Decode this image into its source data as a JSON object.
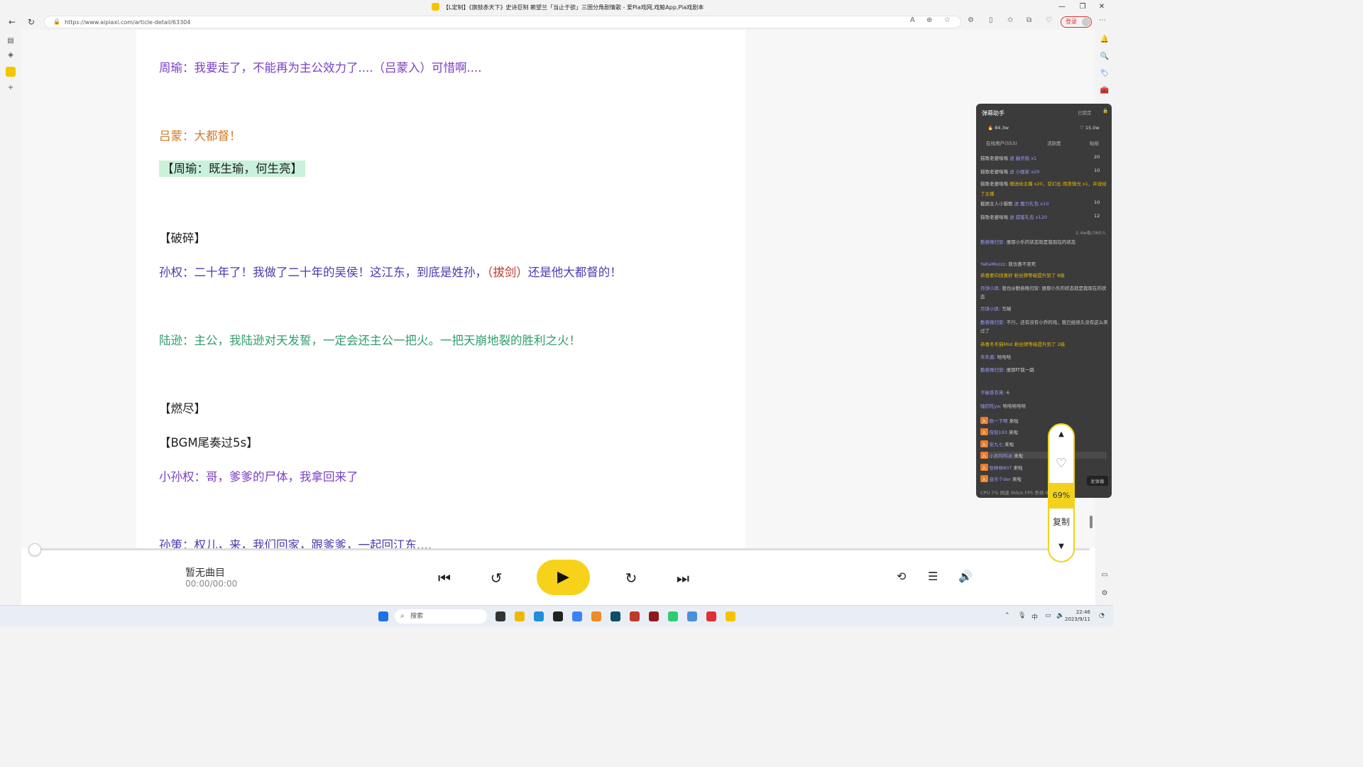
{
  "window": {
    "title": "【L定制】《旗鼓赤天下》史诗巨制 赖望兰「当止于欲」三国分角剧情歌 - 爱Pia戏网,戏鲸App,Pia戏剧本",
    "min_label": "—",
    "restore_label": "❐",
    "close_label": "✕"
  },
  "browser": {
    "url": "https://www.aipiaxi.com/article-detail/63304",
    "login_label": "登录"
  },
  "article": {
    "lines": [
      "周瑜：我要走了，不能再为主公效力了....（吕蒙入）可惜啊....",
      "吕蒙：大都督！",
      "【周瑜：既生瑜，何生亮】",
      "【破碎】",
      "孙权：二十年了！我做了二十年的吴侯！这江东，到底是姓孙，",
      "（拔剑）",
      "还是他大都督的！",
      "陆逊：主公，我陆逊对天发誓，一定会还主公一把火。一把天崩地裂的胜利之火！",
      "【燃尽】",
      "【BGM尾奏过5s】",
      "小孙权：哥，爹爹的尸体，我拿回来了",
      "孙策：权儿，来，我们回家，跟爹爹，一起回江东...."
    ]
  },
  "player": {
    "track_title": "暂无曲目",
    "track_time": "00:00/00:00",
    "progress": 0.0
  },
  "danmu": {
    "title": "弹幕助手",
    "lock_label": "已锁定",
    "hot": "84.3w",
    "likes": "15.0w",
    "tabs": [
      "在线用户(553)",
      "活跃度",
      "贴纸"
    ],
    "viewer_stat": "2.4w条/360人",
    "gifts": [
      {
        "name": "猫歌老婆嗡嗡",
        "text": "送 幽灵船 x1",
        "count": "20"
      },
      {
        "name": "猫歌老婆嗡嗡",
        "text": "送 小画家 x20",
        "count": "10"
      },
      {
        "name": "猫歌老婆嗡嗡",
        "text": "赠送给主播 x20，变幻出 雨夜微光 x1，并说给了主播",
        "count": ""
      },
      {
        "name": "截据主人小猫歌",
        "text": "送 魔力礼包 x10",
        "count": "10"
      },
      {
        "name": "猫歌老婆嗡嗡",
        "text": "送 甜蜜礼包 x120",
        "count": "12"
      }
    ],
    "messages": [
      {
        "user": "勤奋晚归安:",
        "text": "册那小乐的状态就是我现在的状态"
      },
      {
        "user": "YaKaMozzz:",
        "text": "我也喜不至死"
      },
      {
        "user": "",
        "text": "恭喜要向线喜好 粉丝牌等级提升到了 8级"
      },
      {
        "user": "月饼小凤:",
        "text": "我也@勤奋晚归安: 册那小乐的状态就是我现在的状态"
      },
      {
        "user": "月饼小凤:",
        "text": "写贼"
      },
      {
        "user": "勤奋晚归安:",
        "text": "不行，还有没有小乔的戏，我已经很久没有这么笑过了"
      },
      {
        "user": "",
        "text": "恭喜冬冬猫Mist 粉丝牌等级提升到了 2级"
      },
      {
        "user": "朱朱酱:",
        "text": "哈哈哈"
      },
      {
        "user": "勤奋晚归安:",
        "text": "册那吓我一跳"
      },
      {
        "user": "不破茶衣来:",
        "text": "6"
      },
      {
        "user": "嗑药吃ya:",
        "text": "哈哈哈哈哈"
      },
      {
        "user": "欧一下啊",
        "text": "来啦"
      },
      {
        "user": "侃侃193",
        "text": "来啦"
      },
      {
        "user": "安九七",
        "text": "来啦"
      },
      {
        "user": "小风叫叫冰",
        "text": "来啦"
      },
      {
        "user": "张林林807",
        "text": "来啦"
      },
      {
        "user": "音乐个der",
        "text": "来啦"
      }
    ],
    "status": "CPU 7%    网速 0kb/s    FPS    丢帧 0.00%",
    "send_label": "发弹幕"
  },
  "side_widget": {
    "percent": "69%",
    "copy_label": "复制"
  },
  "taskbar": {
    "search_placeholder": "搜索",
    "time": "22:46",
    "date": "2023/9/11",
    "tray_ime": "中"
  }
}
